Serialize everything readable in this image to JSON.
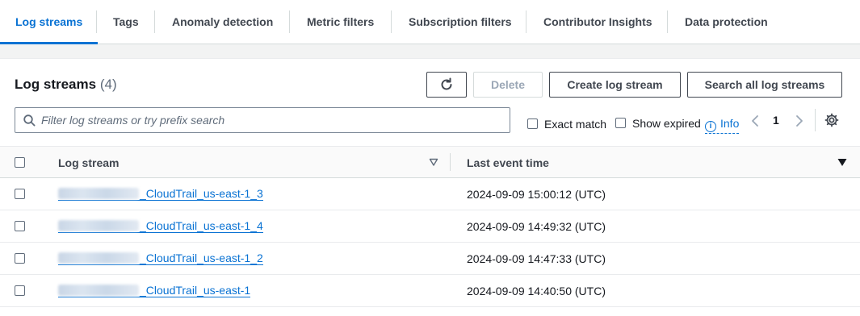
{
  "tabs": [
    {
      "label": "Log streams",
      "active": true
    },
    {
      "label": "Tags"
    },
    {
      "label": "Anomaly detection"
    },
    {
      "label": "Metric filters"
    },
    {
      "label": "Subscription filters"
    },
    {
      "label": "Contributor Insights"
    },
    {
      "label": "Data protection"
    }
  ],
  "panel": {
    "title": "Log streams",
    "count": "(4)",
    "buttons": {
      "refresh_icon": "refresh-icon",
      "delete": "Delete",
      "create": "Create log stream",
      "search_all": "Search all log streams"
    },
    "search": {
      "placeholder": "Filter log streams or try prefix search",
      "value": ""
    },
    "exact_match": "Exact match",
    "show_expired": "Show expired",
    "info": "Info",
    "page": "1"
  },
  "table": {
    "columns": [
      "Log stream",
      "Last event time"
    ],
    "rows": [
      {
        "stream_suffix": "_CloudTrail_us-east-1_3",
        "time": "2024-09-09 15:00:12 (UTC)"
      },
      {
        "stream_suffix": "_CloudTrail_us-east-1_4",
        "time": "2024-09-09 14:49:32 (UTC)"
      },
      {
        "stream_suffix": "_CloudTrail_us-east-1_2",
        "time": "2024-09-09 14:47:33 (UTC)"
      },
      {
        "stream_suffix": "_CloudTrail_us-east-1",
        "time": "2024-09-09 14:40:50 (UTC)"
      }
    ]
  },
  "colors": {
    "accent": "#0972d3",
    "text": "#16191f",
    "muted": "#5f6b7a"
  }
}
